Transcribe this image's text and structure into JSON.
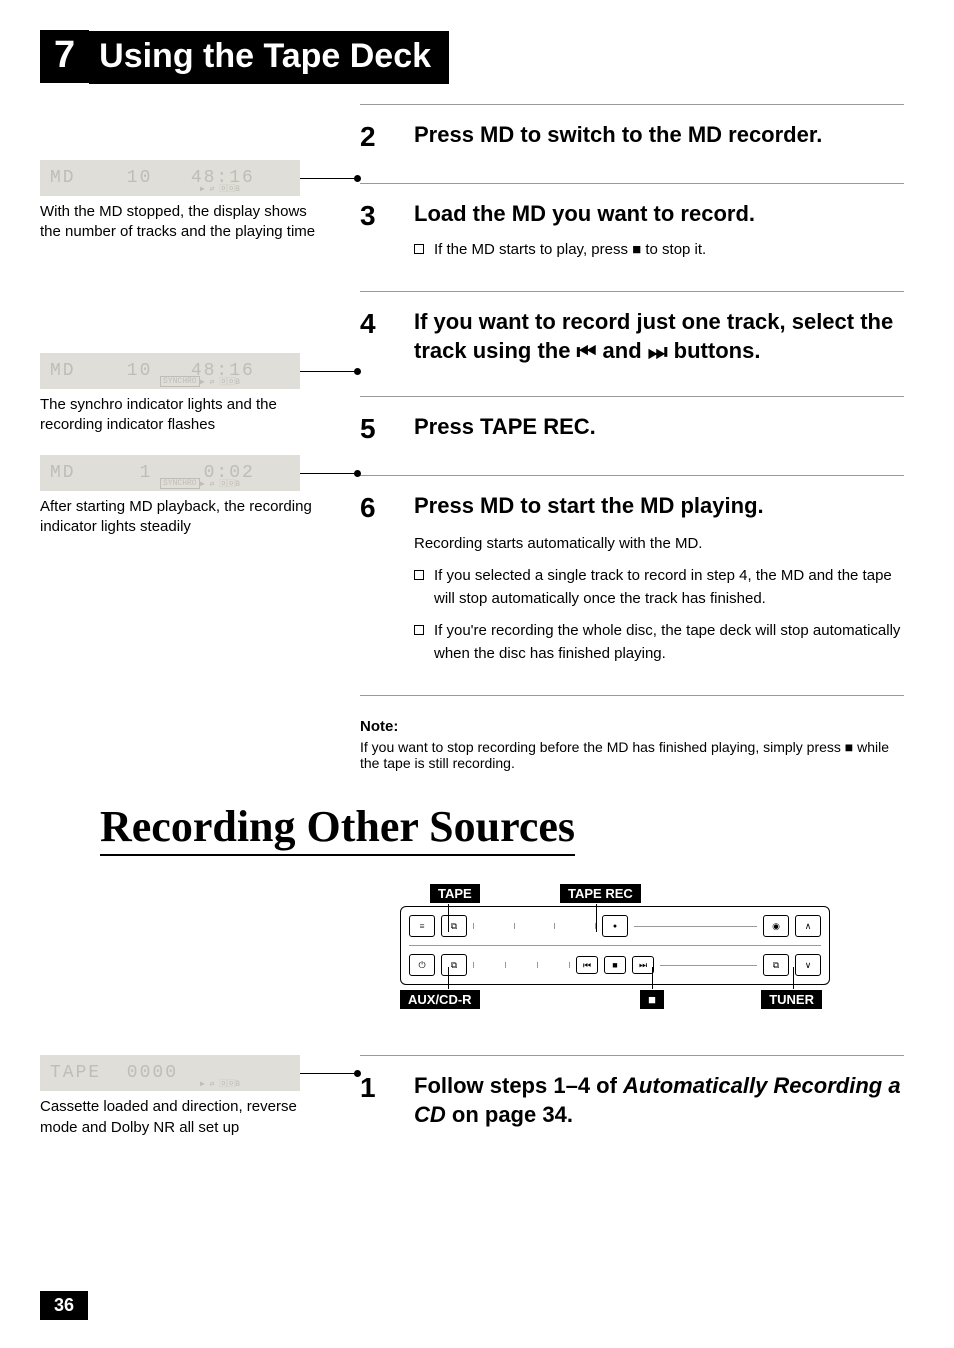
{
  "chapter": {
    "number": "7",
    "title": "Using the Tape Deck"
  },
  "lcd_blocks": [
    {
      "line": "MD    10   48:16",
      "sub": "▶ ⇄ 🄳🄳B",
      "caption": "With the MD stopped, the display shows the number of tracks and the playing time"
    },
    {
      "line": "MD    10   48:16",
      "sub_left": "SYNCHRO",
      "sub": "▶ ⇄ 🄳🄳B",
      "caption": "The synchro indicator lights and the recording indicator flashes"
    },
    {
      "line": "MD     1    0:02",
      "sub_left": "SYNCHRO",
      "sub": "▶ ⇄ 🄳🄳B",
      "caption": "After starting MD playback, the recording indicator lights steadily"
    }
  ],
  "steps": [
    {
      "n": "2",
      "title": "Press MD to switch to the MD recorder."
    },
    {
      "n": "3",
      "title": "Load the MD you want to record.",
      "bullets": [
        "If the MD starts to play, press ■ to stop it."
      ]
    },
    {
      "n": "4",
      "title": "If you want to record just one track, select the track using the ⏮ and ⏭ buttons."
    },
    {
      "n": "5",
      "title": "Press TAPE REC."
    },
    {
      "n": "6",
      "title": "Press MD to start the MD playing.",
      "detail": "Recording starts automatically with the MD.",
      "bullets": [
        "If you selected a single track to record in step 4, the MD and the tape will stop automatically once the track has finished.",
        "If you're recording the whole disc, the tape deck will stop automatically when the disc has finished playing."
      ]
    }
  ],
  "note": {
    "label": "Note:",
    "text": "If you want to stop recording before the MD has finished playing, simply press ■ while the tape is still recording."
  },
  "section2": {
    "title": "Recording Other Sources",
    "labels": {
      "tape": "TAPE",
      "tape_rec": "TAPE REC",
      "aux": "AUX/CD-R",
      "stop": "■",
      "tuner": "TUNER"
    },
    "lcd": {
      "line": "TAPE  0000",
      "sub": "▶ ⇄ 🄳🄳B",
      "caption": "Cassette loaded and direction, reverse mode and Dolby NR all set up"
    },
    "step": {
      "n": "1",
      "title_pre": "Follow steps 1–4 of ",
      "title_em1": "Automatically Recording a CD",
      "title_post": " on page 34."
    }
  },
  "page_number": "36"
}
